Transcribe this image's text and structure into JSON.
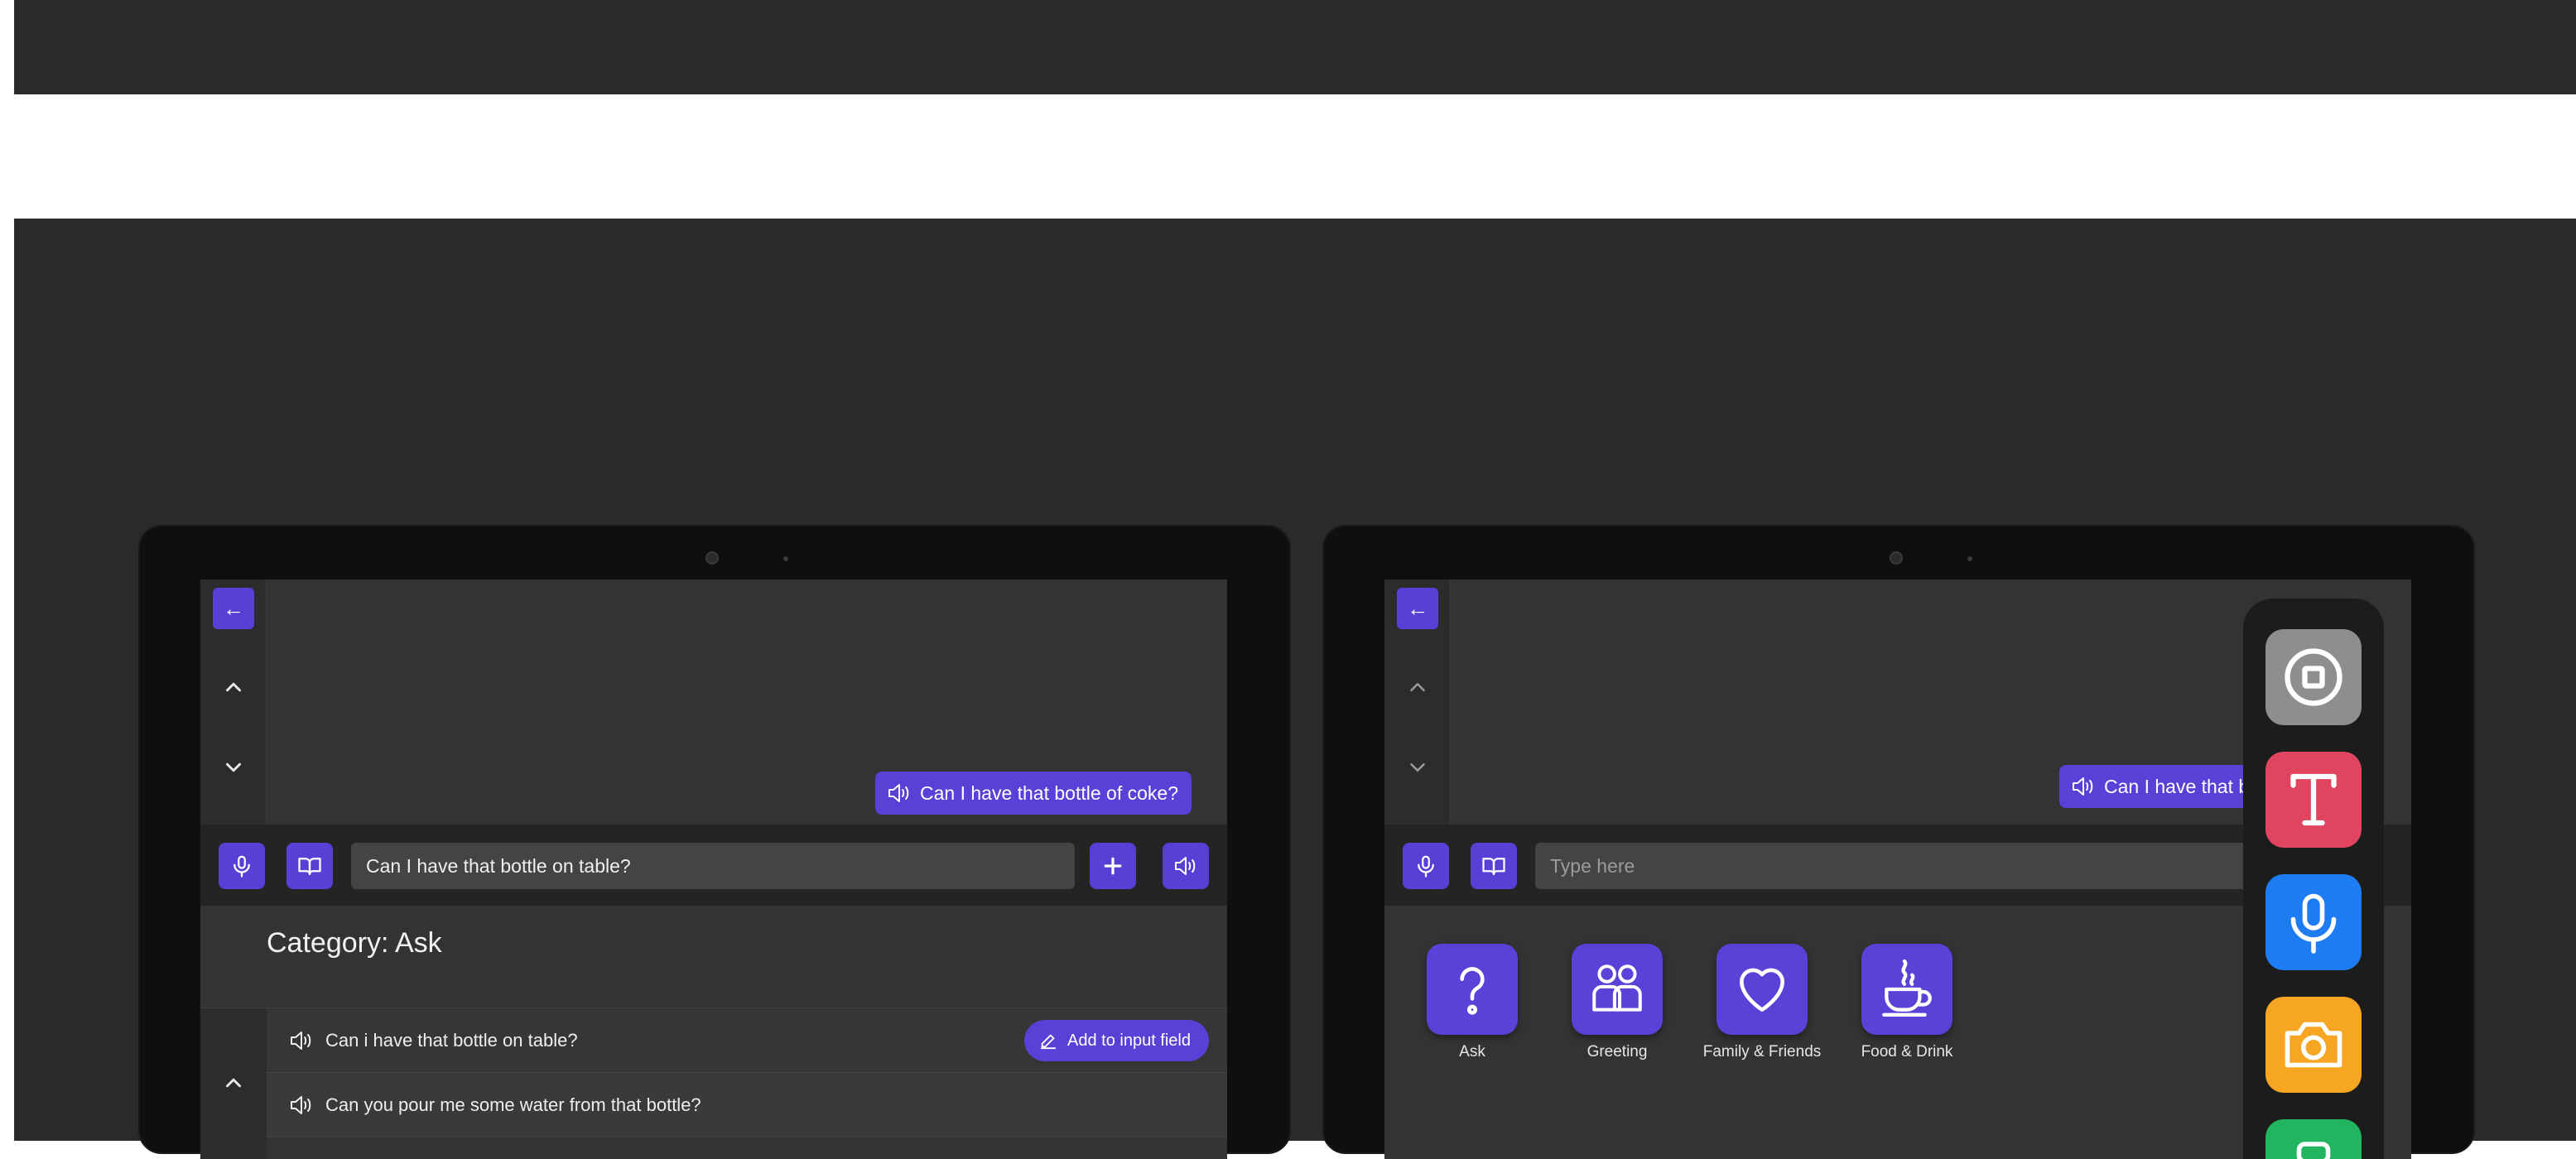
{
  "left_screen": {
    "back_label": "←",
    "spoken_bubble": "Can I have that bottle of coke?",
    "input_value": "Can I have that bottle on table?",
    "category_title": "Category: Ask",
    "phrases": [
      {
        "text": "Can i have that bottle on table?",
        "action": "Add to input field"
      },
      {
        "text": "Can you pour me some water from that bottle?"
      }
    ]
  },
  "right_screen": {
    "back_label": "←",
    "spoken_bubble": "Can I have that b",
    "input_placeholder": "Type here",
    "categories": [
      {
        "label": "Ask",
        "icon": "question-icon"
      },
      {
        "label": "Greeting",
        "icon": "people-icon"
      },
      {
        "label": "Family & Friends",
        "icon": "heart-icon"
      },
      {
        "label": "Food & Drink",
        "icon": "coffee-cup-icon"
      }
    ],
    "dock_apps": [
      {
        "icon": "stop-square-icon",
        "color": "#8e8e8e"
      },
      {
        "icon": "text-t-icon",
        "color": "#e0445e"
      },
      {
        "icon": "microphone-icon",
        "color": "#1e7cf2"
      },
      {
        "icon": "camera-icon",
        "color": "#f6a623"
      },
      {
        "icon": "green-app-icon",
        "color": "#22b55f"
      }
    ]
  },
  "colors": {
    "accent": "#5640d6",
    "stage_background": "#2a2a2a",
    "tablet_bezel": "#0f0f0f",
    "screen_background": "#333333"
  }
}
